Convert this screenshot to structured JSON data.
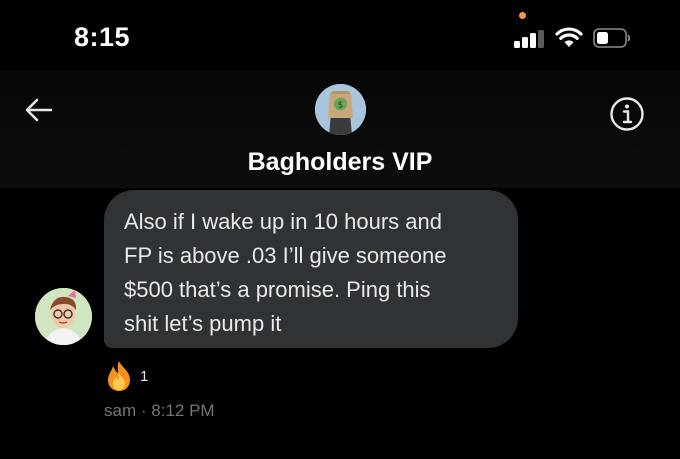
{
  "status_bar": {
    "time": "8:15",
    "icons": [
      "cellular-signal-icon",
      "wifi-icon",
      "battery-icon"
    ],
    "privacy_dot_color": "#f19a3e"
  },
  "header": {
    "back_icon": "arrow-left-icon",
    "info_icon": "info-circle-icon",
    "group_name": "Bagholders VIP"
  },
  "message": {
    "text": "Also if I wake up in 10 hours and\nFP is above .03 I’ll give someone\n$500 that’s a promise. Ping this\nshit let’s pump it",
    "reaction": {
      "emoji": "fire-emoji",
      "count": "1"
    },
    "sender": "sam",
    "separator": "·",
    "time": "8:12 PM"
  },
  "colors": {
    "background": "#000000",
    "bubble": "#2f3336",
    "text": "#e7e9ea",
    "muted": "#71767b"
  }
}
